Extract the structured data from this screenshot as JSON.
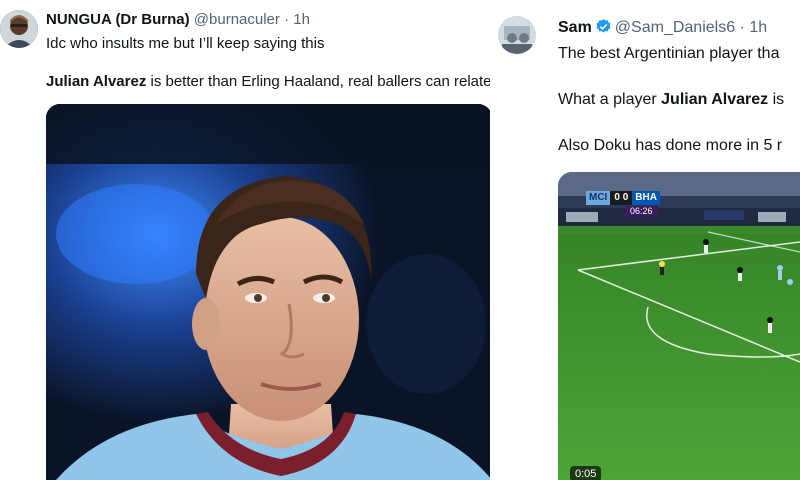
{
  "tweet_left": {
    "name": "NUNGUA (Dr Burna)",
    "handle": "@burnaculer",
    "dot": "·",
    "time": "1h",
    "line1": "Idc who insults me but  I’ll keep saying this",
    "line2_bold": "Julian Alvarez",
    "line2_rest": " is better than Erling Haaland, real ballers can relate",
    "avatar_icon": "profile-avatar",
    "media_icon": "player-photo"
  },
  "tweet_right": {
    "name": "Sam",
    "handle": "@Sam_Daniels6",
    "dot": "·",
    "time": "1h",
    "verified_icon": "verified-badge-icon",
    "line1": "The best Argentinian player tha",
    "line2_pre": "What a player ",
    "line2_bold": "Julian Alvarez",
    "line2_post": " is",
    "line3": "Also Doku has done more in 5 r",
    "video": {
      "home": "MCI",
      "away": "BHA",
      "home_score": "0",
      "away_score": "0",
      "clock": "06:26",
      "duration": "0:05",
      "media_icon": "match-video"
    }
  },
  "colors": {
    "text_primary": "#0f1419",
    "text_secondary": "#536471",
    "verified_blue": "#1d9bf0"
  }
}
